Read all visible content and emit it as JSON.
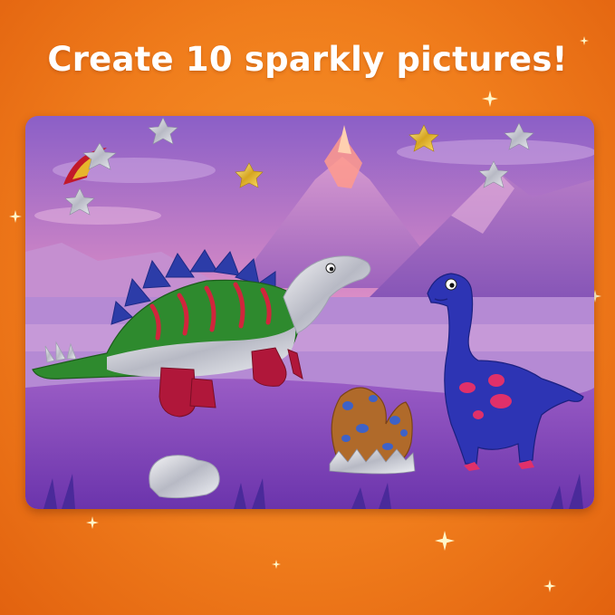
{
  "headline": "Create 10 sparkly pictures!",
  "colors": {
    "background": "#f08020",
    "headline_text": "#ffffff",
    "sky_top": "#8f63c9",
    "sky_bottom": "#f3a7c7",
    "ground": "#7a3fb6",
    "stegosaurus_body": "#2e8a2e",
    "stegosaurus_plates": "#2f3fa8",
    "stegosaurus_feet": "#b0173a",
    "brontosaurus_body": "#2d34b4",
    "brontosaurus_spots": "#e0306a",
    "egg": "#b06a2a",
    "egg_spots": "#3e62c7"
  },
  "scene": {
    "stickers": [
      {
        "name": "stegosaurus-sticker"
      },
      {
        "name": "brontosaurus-sticker"
      },
      {
        "name": "dino-egg-sticker"
      },
      {
        "name": "rock-sticker"
      },
      {
        "name": "comet-sticker"
      },
      {
        "name": "star-stickers"
      }
    ]
  }
}
